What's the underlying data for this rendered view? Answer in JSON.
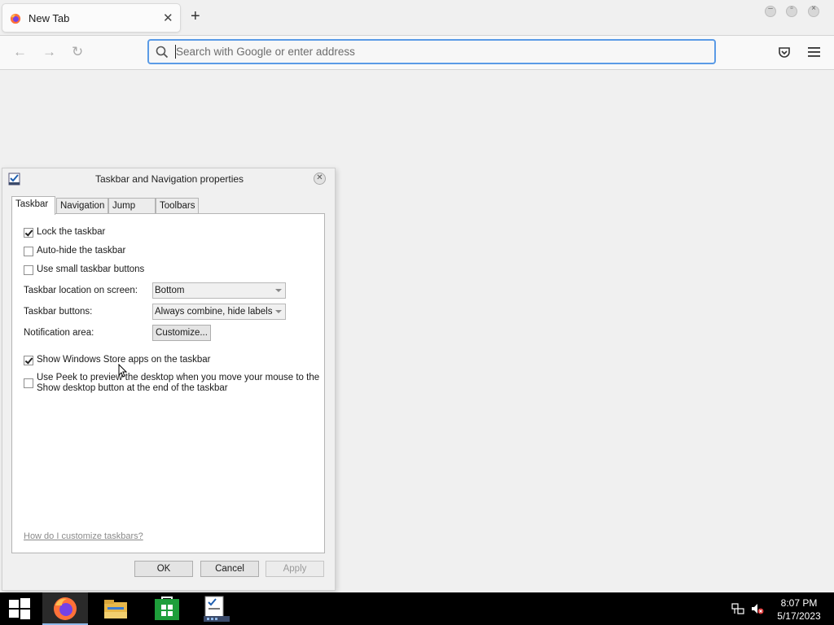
{
  "browser": {
    "tab_title": "New Tab",
    "tab_close": "✕",
    "new_tab": "+",
    "url_placeholder": "Search with Google or enter address",
    "nav": {
      "back": "←",
      "forward": "→",
      "reload": "↻"
    },
    "window_controls": [
      "minimize",
      "restore",
      "close"
    ]
  },
  "dialog": {
    "title": "Taskbar and Navigation properties",
    "tabs": [
      "Taskbar",
      "Navigation",
      "Jump Lists",
      "Toolbars"
    ],
    "active_tab": "Taskbar",
    "checkboxes": [
      {
        "label": "Lock the taskbar",
        "checked": true
      },
      {
        "label": "Auto-hide the taskbar",
        "checked": false
      },
      {
        "label": "Use small taskbar buttons",
        "checked": false
      }
    ],
    "location": {
      "label": "Taskbar location on screen:",
      "value": "Bottom"
    },
    "buttons_setting": {
      "label": "Taskbar buttons:",
      "value": "Always combine, hide labels"
    },
    "notification": {
      "label": "Notification area:",
      "button": "Customize..."
    },
    "store_apps": {
      "label": "Show Windows Store apps on the taskbar",
      "checked": true
    },
    "peek": {
      "line1": "Use Peek to preview the desktop when you move your mouse to the",
      "line2": "Show desktop button at the end of the taskbar",
      "checked": false
    },
    "help_link": "How do I customize taskbars?",
    "ok": "OK",
    "cancel": "Cancel",
    "apply": "Apply"
  },
  "taskbar": {
    "items": [
      "start-icon",
      "firefox-icon",
      "file-explorer-icon",
      "store-icon",
      "taskbar-properties-icon"
    ],
    "time": "8:07 PM",
    "date": "5/17/2023"
  },
  "colors": {
    "url_focus": "#5b9be6",
    "taskbar": "#000000",
    "store_green": "#1e9e3a"
  }
}
